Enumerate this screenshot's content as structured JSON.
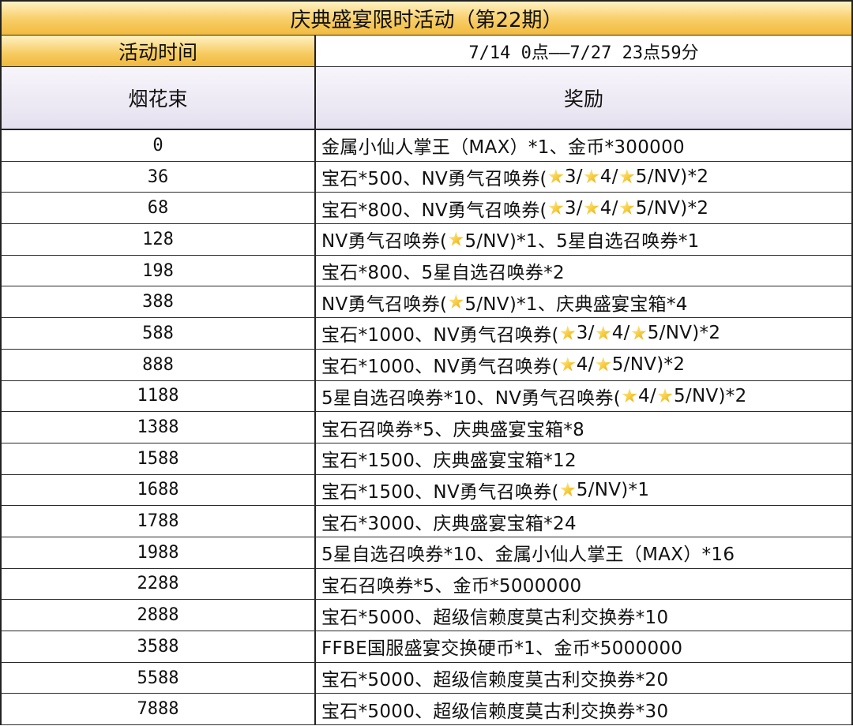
{
  "title": "庆典盛宴限时活动（第22期）",
  "time_label": "活动时间",
  "time_value": "7/14 0点——7/27 23点59分",
  "headers": {
    "col1": "烟花束",
    "col2": "奖励"
  },
  "star_icon": "gold-star-icon",
  "rows": [
    {
      "threshold": "0",
      "reward": "金属小仙人掌王（MAX）*1、金币*300000"
    },
    {
      "threshold": "36",
      "reward": "宝石*500、NV勇气召唤券(★3/★4/★5/NV)*2"
    },
    {
      "threshold": "68",
      "reward": "宝石*800、NV勇气召唤券(★3/★4/★5/NV)*2"
    },
    {
      "threshold": "128",
      "reward": "NV勇气召唤券(★5/NV)*1、5星自选召唤券*1"
    },
    {
      "threshold": "198",
      "reward": "宝石*800、5星自选召唤券*2"
    },
    {
      "threshold": "388",
      "reward": "NV勇气召唤券(★5/NV)*1、庆典盛宴宝箱*4"
    },
    {
      "threshold": "588",
      "reward": "宝石*1000、NV勇气召唤券(★3/★4/★5/NV)*2"
    },
    {
      "threshold": "888",
      "reward": "宝石*1000、NV勇气召唤券(★4/★5/NV)*2"
    },
    {
      "threshold": "1188",
      "reward": "5星自选召唤券*10、NV勇气召唤券(★4/★5/NV)*2"
    },
    {
      "threshold": "1388",
      "reward": "宝石召唤券*5、庆典盛宴宝箱*8"
    },
    {
      "threshold": "1588",
      "reward": "宝石*1500、庆典盛宴宝箱*12"
    },
    {
      "threshold": "1688",
      "reward": "宝石*1500、NV勇气召唤券(★5/NV)*1"
    },
    {
      "threshold": "1788",
      "reward": "宝石*3000、庆典盛宴宝箱*24"
    },
    {
      "threshold": "1988",
      "reward": "5星自选召唤券*10、金属小仙人掌王（MAX）*16"
    },
    {
      "threshold": "2288",
      "reward": "宝石召唤券*5、金币*5000000"
    },
    {
      "threshold": "2888",
      "reward": "宝石*5000、超级信赖度莫古利交换券*10"
    },
    {
      "threshold": "3588",
      "reward": "FFBE国服盛宴交换硬币*1、金币*5000000"
    },
    {
      "threshold": "5588",
      "reward": "宝石*5000、超级信赖度莫古利交换券*20"
    },
    {
      "threshold": "7888",
      "reward": "宝石*5000、超级信赖度莫古利交换券*30"
    }
  ]
}
